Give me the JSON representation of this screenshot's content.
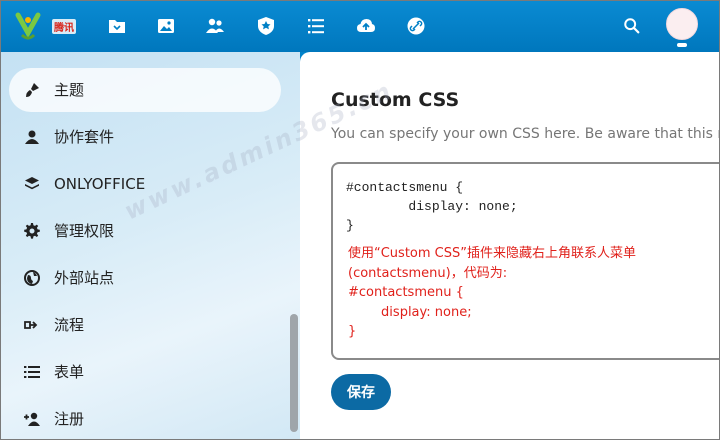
{
  "header": {
    "logo_text": "腾讯",
    "apps": [
      {
        "icon": "files-icon"
      },
      {
        "icon": "photos-icon"
      },
      {
        "icon": "contacts-icon"
      },
      {
        "icon": "security-icon"
      },
      {
        "icon": "tasks-icon"
      },
      {
        "icon": "upload-icon"
      },
      {
        "icon": "link-icon"
      }
    ],
    "search_icon": "search-icon",
    "avatar_color": "#fbeef0",
    "accent_color": "#0082c9"
  },
  "sidebar": {
    "items": [
      {
        "label": "主题",
        "icon": "paintbrush-icon",
        "active": true
      },
      {
        "label": "协作套件",
        "icon": "user-icon",
        "active": false
      },
      {
        "label": "ONLYOFFICE",
        "icon": "layers-icon",
        "active": false
      },
      {
        "label": "管理权限",
        "icon": "gear-icon",
        "active": false
      },
      {
        "label": "外部站点",
        "icon": "globe-icon",
        "active": false
      },
      {
        "label": "流程",
        "icon": "flow-icon",
        "active": false
      },
      {
        "label": "表单",
        "icon": "list-icon",
        "active": false
      },
      {
        "label": "注册",
        "icon": "user-add-icon",
        "active": false
      }
    ]
  },
  "main": {
    "title": "Custom CSS",
    "description": "You can specify your own CSS here. Be aware that this might",
    "editor": {
      "code": "#contactsmenu {\n        display: none;\n}",
      "annotation": "使用“Custom CSS”插件来隐藏右上角联系人菜单\n(contactsmenu)，代码为:\n#contactsmenu {\n        display: none;\n}"
    },
    "save_label": "保存",
    "save_color": "#0c6aa4",
    "annotation_color": "#e0211b"
  },
  "watermark": "www.admin365.cn"
}
